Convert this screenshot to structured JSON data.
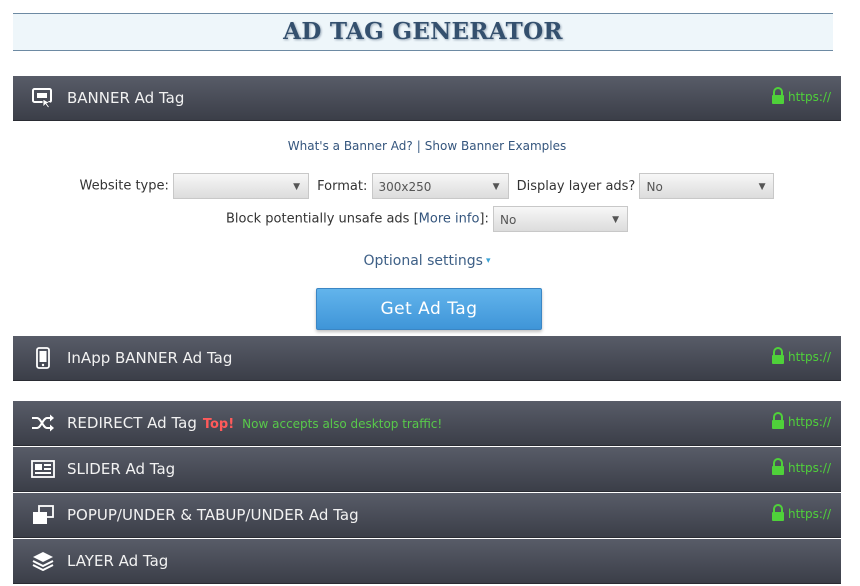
{
  "title": "AD TAG GENERATOR",
  "https_label": "https://",
  "banner": {
    "label": "BANNER Ad Tag",
    "links": {
      "whats_banner": "What's a Banner Ad?",
      "separator": "|",
      "show_examples": "Show Banner Examples"
    },
    "fields": {
      "website_type_label": "Website type:",
      "website_type_value": "",
      "format_label": "Format:",
      "format_value": "300x250",
      "display_layer_label": "Display layer ads?",
      "display_layer_value": "No",
      "block_unsafe_label_pre": "Block potentially unsafe ads [",
      "block_unsafe_more_info": "More info",
      "block_unsafe_label_post": "]:",
      "block_unsafe_value": "No"
    },
    "optional_settings": "Optional settings",
    "get_button": "Get Ad Tag"
  },
  "sections": {
    "inapp": {
      "label": "InApp BANNER Ad Tag"
    },
    "redirect": {
      "label": "REDIRECT Ad Tag",
      "badge": "Top!",
      "note": "Now accepts also desktop traffic!"
    },
    "slider": {
      "label": "SLIDER Ad Tag"
    },
    "popup": {
      "label": "POPUP/UNDER & TABUP/UNDER Ad Tag"
    },
    "layer": {
      "label": "LAYER Ad Tag"
    }
  },
  "icons": {
    "banner": "banner-icon",
    "inapp": "smartphone-icon",
    "redirect": "shuffle-icon",
    "slider": "slider-icon",
    "popup": "popup-windows-icon",
    "layer": "layers-icon",
    "lock": "lock-icon",
    "dropdown": "chevron-down-icon"
  },
  "colors": {
    "section_bg": "#4a4d58",
    "https_green": "#4fd13a",
    "button_blue": "#4fa5e2",
    "top_badge": "#ff5a5a",
    "note_green": "#58c94a",
    "link_blue": "#34557d"
  }
}
